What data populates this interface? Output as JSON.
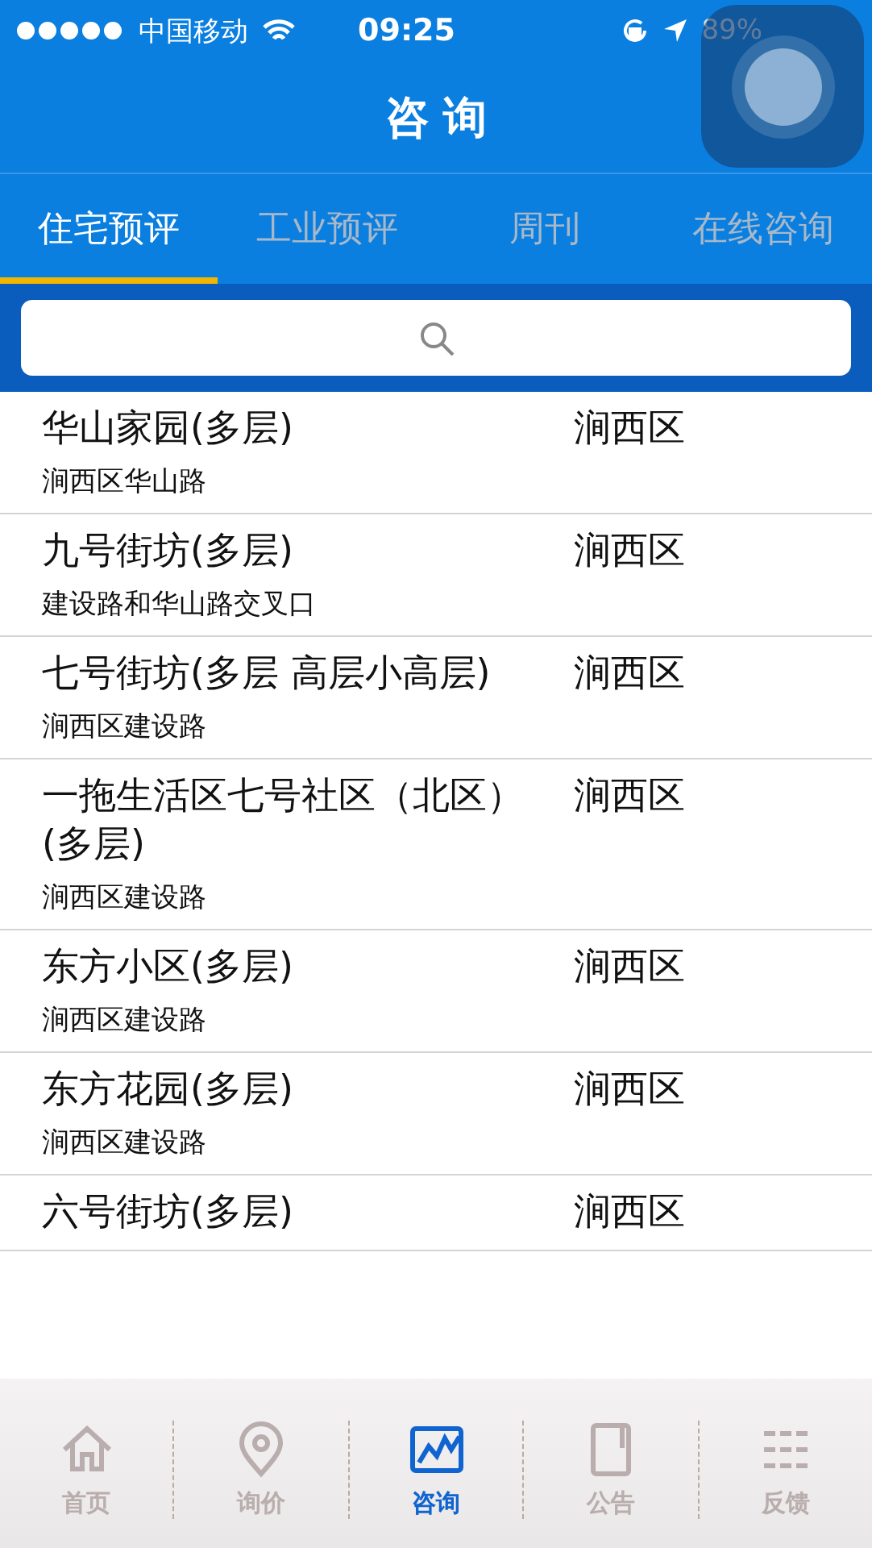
{
  "status_bar": {
    "carrier": "中国移动",
    "time": "09:25",
    "battery": "89%"
  },
  "nav": {
    "title": "咨 询"
  },
  "tabs": [
    {
      "label": "住宅预评",
      "selected": true
    },
    {
      "label": "工业预评",
      "selected": false
    },
    {
      "label": "周刊",
      "selected": false
    },
    {
      "label": "在线咨询",
      "selected": false
    }
  ],
  "list": [
    {
      "name": "华山家园(多层)",
      "district": "涧西区",
      "address": "涧西区华山路"
    },
    {
      "name": "九号街坊(多层)",
      "district": "涧西区",
      "address": "建设路和华山路交叉口"
    },
    {
      "name": "七号街坊(多层 高层小高层)",
      "district": "涧西区",
      "address": "涧西区建设路"
    },
    {
      "name": "一拖生活区七号社区（北区）(多层)",
      "district": "涧西区",
      "address": "涧西区建设路"
    },
    {
      "name": "东方小区(多层)",
      "district": "涧西区",
      "address": "涧西区建设路"
    },
    {
      "name": "东方花园(多层)",
      "district": "涧西区",
      "address": "涧西区建设路"
    },
    {
      "name": "六号街坊(多层)",
      "district": "涧西区"
    }
  ],
  "tab_bar": [
    {
      "kind": "home",
      "label": "首页",
      "selected": false
    },
    {
      "kind": "pin",
      "label": "询价",
      "selected": false
    },
    {
      "kind": "chart",
      "label": "咨询",
      "selected": true
    },
    {
      "kind": "book",
      "label": "公告",
      "selected": false
    },
    {
      "kind": "list",
      "label": "反馈",
      "selected": false
    }
  ]
}
